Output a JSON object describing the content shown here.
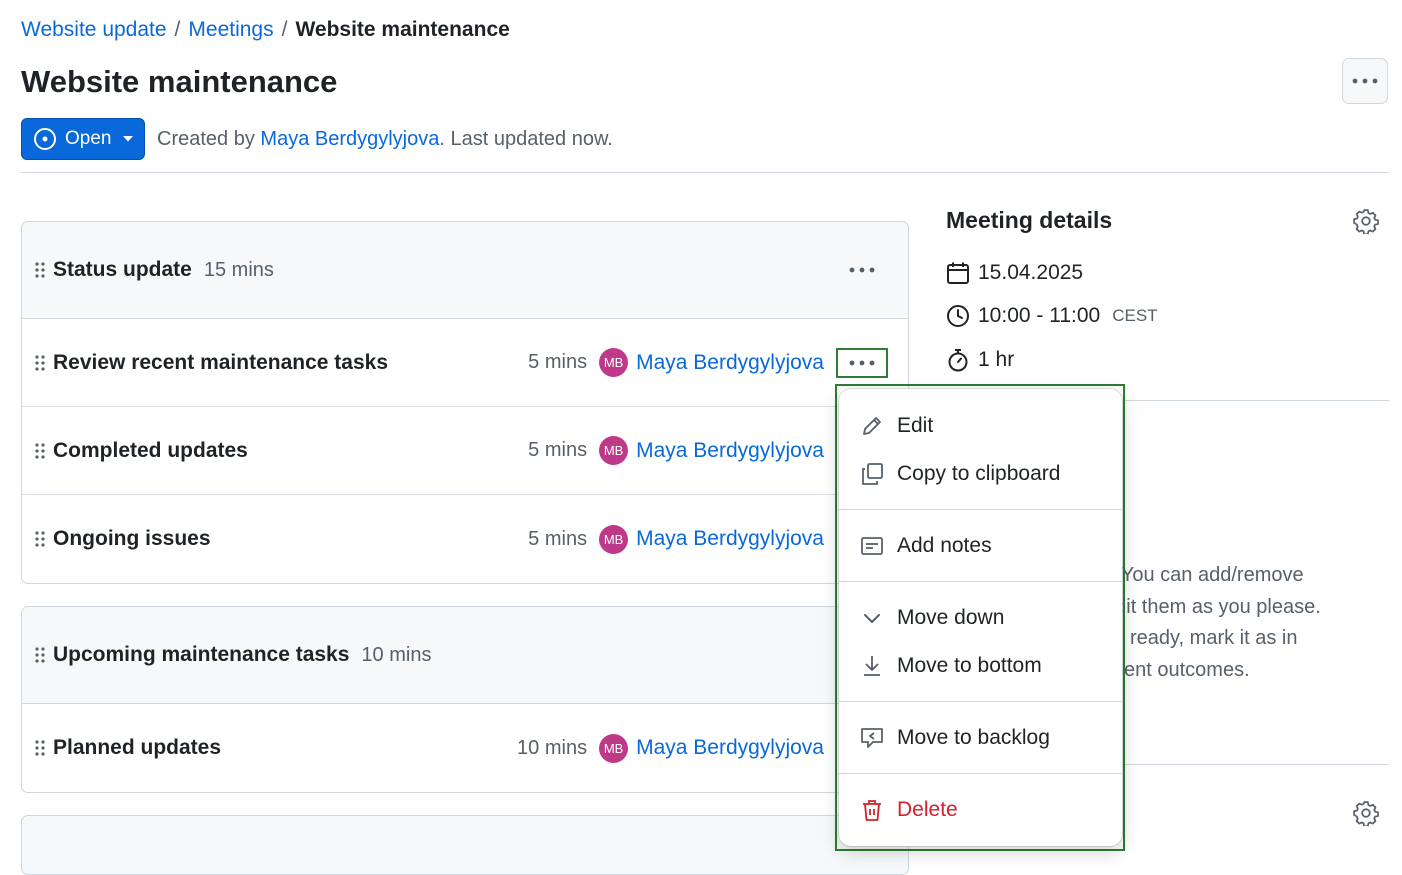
{
  "breadcrumb": {
    "items": [
      "Website update",
      "Meetings"
    ],
    "current": "Website maintenance",
    "separator": "/"
  },
  "page": {
    "title": "Website maintenance"
  },
  "status": {
    "label": "Open",
    "created_prefix": "Created by",
    "author": "Maya Berdygylyjova",
    "updated_text": ". Last updated now."
  },
  "agenda": {
    "sections": [
      {
        "title": "Status update",
        "duration": "15 mins",
        "items": [
          {
            "title": "Review recent maintenance tasks",
            "duration": "5 mins",
            "initials": "MB",
            "person": "Maya Berdygylyjova"
          },
          {
            "title": "Completed updates",
            "duration": "5 mins",
            "initials": "MB",
            "person": "Maya Berdygylyjova"
          },
          {
            "title": "Ongoing issues",
            "duration": "5 mins",
            "initials": "MB",
            "person": "Maya Berdygylyjova"
          }
        ]
      },
      {
        "title": "Upcoming maintenance tasks",
        "duration": "10 mins",
        "items": [
          {
            "title": "Planned updates",
            "duration": "10 mins",
            "initials": "MB",
            "person": "Maya Berdygylyjova"
          }
        ]
      }
    ]
  },
  "details": {
    "title": "Meeting details",
    "date": "15.04.2025",
    "time": "10:00 - 11:00",
    "timezone": "CEST",
    "duration": "1 hr"
  },
  "background_text": [
    "n. You can add/remove",
    "edit them as you please.",
    "ready, mark it as in",
    "ent outcomes."
  ],
  "menu": {
    "edit": "Edit",
    "copy": "Copy to clipboard",
    "add_notes": "Add notes",
    "move_down": "Move down",
    "move_bottom": "Move to bottom",
    "move_backlog": "Move to backlog",
    "delete": "Delete"
  },
  "colors": {
    "accent": "#0969da",
    "avatar": "#bf3989",
    "danger": "#cf222e",
    "highlight": "#2e7d32"
  }
}
